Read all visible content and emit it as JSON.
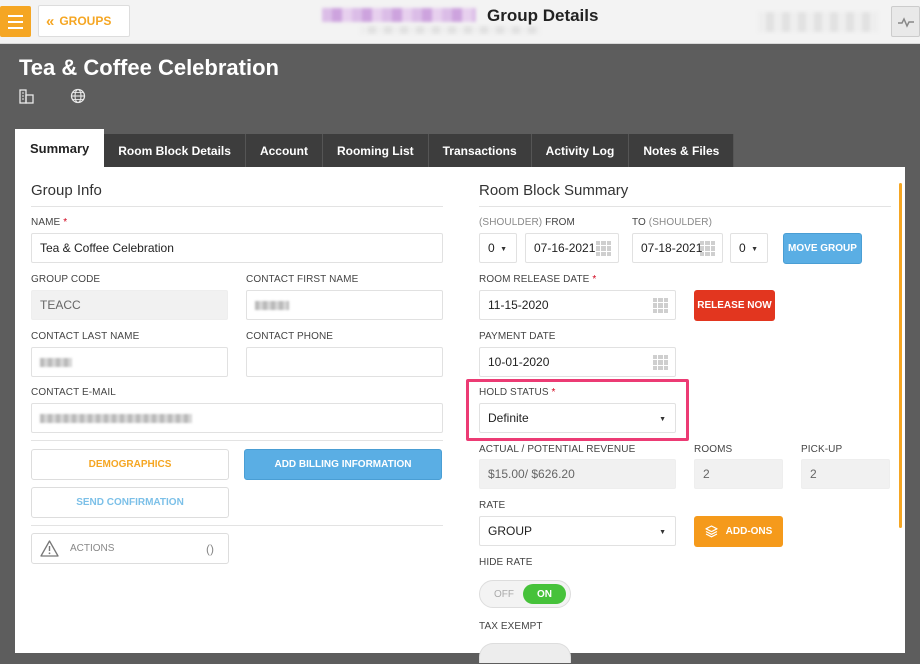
{
  "topbar": {
    "groups_label": "GROUPS",
    "title": "Group Details"
  },
  "group": {
    "name": "Tea & Coffee Celebration"
  },
  "tabs": [
    {
      "label": "Summary",
      "active": true
    },
    {
      "label": "Room Block Details"
    },
    {
      "label": "Account"
    },
    {
      "label": "Rooming List"
    },
    {
      "label": "Transactions"
    },
    {
      "label": "Activity Log"
    },
    {
      "label": "Notes & Files"
    }
  ],
  "group_info": {
    "title": "Group Info",
    "name_label": "NAME",
    "name_value": "Tea & Coffee Celebration",
    "group_code_label": "GROUP CODE",
    "group_code_value": "TEACC",
    "contact_first_label": "CONTACT FIRST NAME",
    "contact_last_label": "CONTACT LAST NAME",
    "contact_phone_label": "CONTACT PHONE",
    "contact_email_label": "CONTACT E-MAIL",
    "demographics_label": "DEMOGRAPHICS",
    "add_billing_label": "ADD BILLING INFORMATION",
    "send_confirmation_label": "SEND CONFIRMATION",
    "actions_label": "ACTIONS",
    "actions_count": "()"
  },
  "room_block": {
    "title": "Room Block Summary",
    "shoulder_from_prefix": "(SHOULDER)",
    "shoulder_from_label": "FROM",
    "shoulder_to_label": "TO",
    "shoulder_to_suffix": "(SHOULDER)",
    "shoulder_from_value": "0",
    "from_date": "07-16-2021",
    "to_date": "07-18-2021",
    "shoulder_to_value": "0",
    "move_group_label": "MOVE GROUP",
    "release_date_label": "ROOM RELEASE DATE",
    "release_date_value": "11-15-2020",
    "release_now_label": "RELEASE NOW",
    "payment_date_label": "PAYMENT DATE",
    "payment_date_value": "10-01-2020",
    "hold_status_label": "HOLD STATUS",
    "hold_status_value": "Definite",
    "revenue_label": "ACTUAL / POTENTIAL REVENUE",
    "revenue_value": "$15.00/ $626.20",
    "rooms_label": "ROOMS",
    "rooms_value": "2",
    "pickup_label": "PICK-UP",
    "pickup_value": "2",
    "rate_label": "RATE",
    "rate_value": "GROUP",
    "addons_label": "ADD-ONS",
    "hide_rate_label": "HIDE RATE",
    "hide_rate_off": "OFF",
    "hide_rate_on": "ON",
    "tax_exempt_label": "TAX EXEMPT"
  },
  "colors": {
    "accent_orange": "#f5a623",
    "highlight_pink": "#ec3b74",
    "toggle_green": "#46c23a",
    "button_blue": "#5aaee4",
    "button_red": "#e2361f"
  }
}
